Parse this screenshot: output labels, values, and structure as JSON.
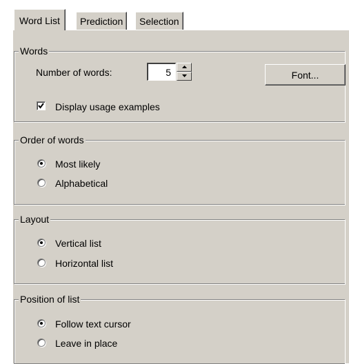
{
  "tabs": [
    {
      "label": "Word List",
      "active": true
    },
    {
      "label": "Prediction",
      "active": false
    },
    {
      "label": "Selection",
      "active": false
    }
  ],
  "words_group": {
    "title": "Words",
    "number_label": "Number of words:",
    "number_value": "5",
    "font_button": "Font...",
    "usage_checkbox": {
      "label": "Display usage examples",
      "checked": true
    }
  },
  "order_group": {
    "title": "Order of words",
    "options": [
      {
        "label": "Most likely",
        "selected": true
      },
      {
        "label": "Alphabetical",
        "selected": false
      }
    ]
  },
  "layout_group": {
    "title": "Layout",
    "options": [
      {
        "label": "Vertical list",
        "selected": true
      },
      {
        "label": "Horizontal list",
        "selected": false
      }
    ]
  },
  "position_group": {
    "title": "Position of list",
    "options": [
      {
        "label": "Follow text cursor",
        "selected": true
      },
      {
        "label": "Leave in place",
        "selected": false
      }
    ]
  }
}
